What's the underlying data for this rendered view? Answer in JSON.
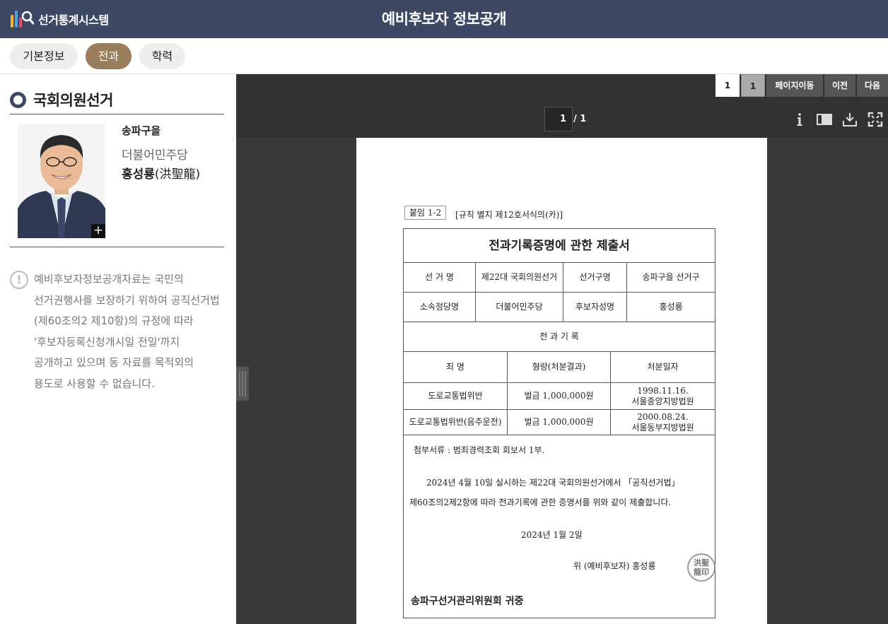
{
  "header": {
    "logo_text": "선거통계시스템",
    "page_title": "예비후보자 정보공개",
    "bg_color": "#3d4865"
  },
  "tabs": [
    {
      "label": "기본정보",
      "active": false
    },
    {
      "label": "전과",
      "active": true
    },
    {
      "label": "학력",
      "active": false
    }
  ],
  "sidebar": {
    "section_title": "국회의원선거",
    "district": "송파구을",
    "party": "더불어민주당",
    "name": "홍성룡",
    "name_hanja": "(洪聖龍)",
    "photo_expand_label": "+",
    "notice_icon": "!",
    "notice_lines": [
      "예비후보자정보공개자료는 국민의",
      "선거권행사를 보장하기 위하여 공직선거법",
      "(제60조의2 제10항)의 규정에 따라",
      "'후보자등록신청개시일 전일'까지",
      "공개하고 있으며 동 자료를 목적외의",
      "용도로 사용할 수 없습니다."
    ]
  },
  "viewer": {
    "page_buttons": [
      "1",
      "1",
      "페이지이동",
      "이전",
      "다음"
    ],
    "page_input": "1",
    "page_total": "/ 1",
    "tool_icons": [
      "info-icon",
      "sidebar-toggle-icon",
      "download-icon",
      "fullscreen-icon"
    ]
  },
  "document": {
    "tag": "붙임 1-2",
    "ref": "[규칙 별지 제12호서식의(카)]",
    "title": "전과기록증명에 관한 제출서",
    "row1": [
      "선  거  명",
      "제22대 국회의원선거",
      "선거구명",
      "송파구을 선거구"
    ],
    "row2": [
      "소속정당명",
      "더불어민주당",
      "후보자성명",
      "홍성룡"
    ],
    "section": "전  과  기  록",
    "headers": [
      "죄  명",
      "형량(처분결과)",
      "처분일자"
    ],
    "records": [
      {
        "crime": "도로교통법위반",
        "sentence": "벌금 1,000,000원",
        "date": "1998.11.16.",
        "court": "서울중앙지방법원"
      },
      {
        "crime": "도로교통법위반(음주운전)",
        "sentence": "벌금 1,000,000원",
        "date": "2000.08.24.",
        "court": "서울동부지방법원"
      }
    ],
    "attachment": "첨부서류 : 범죄경력조회 회보서 1부.",
    "body_line1": "2024년  4월  10일  실시하는  제22대  국회의원선거에서  「공직선거법」",
    "body_line2": "제60조의2제2항에  따라  전과기록에  관한  증명서를  위와  같이  제출합니다.",
    "date": "2024년    1월    2일",
    "signature": "위  (예비후보자)    홍성룡",
    "seal_text": "洪聖龍印",
    "recipient": "송파구선거관리위원회 귀중"
  }
}
